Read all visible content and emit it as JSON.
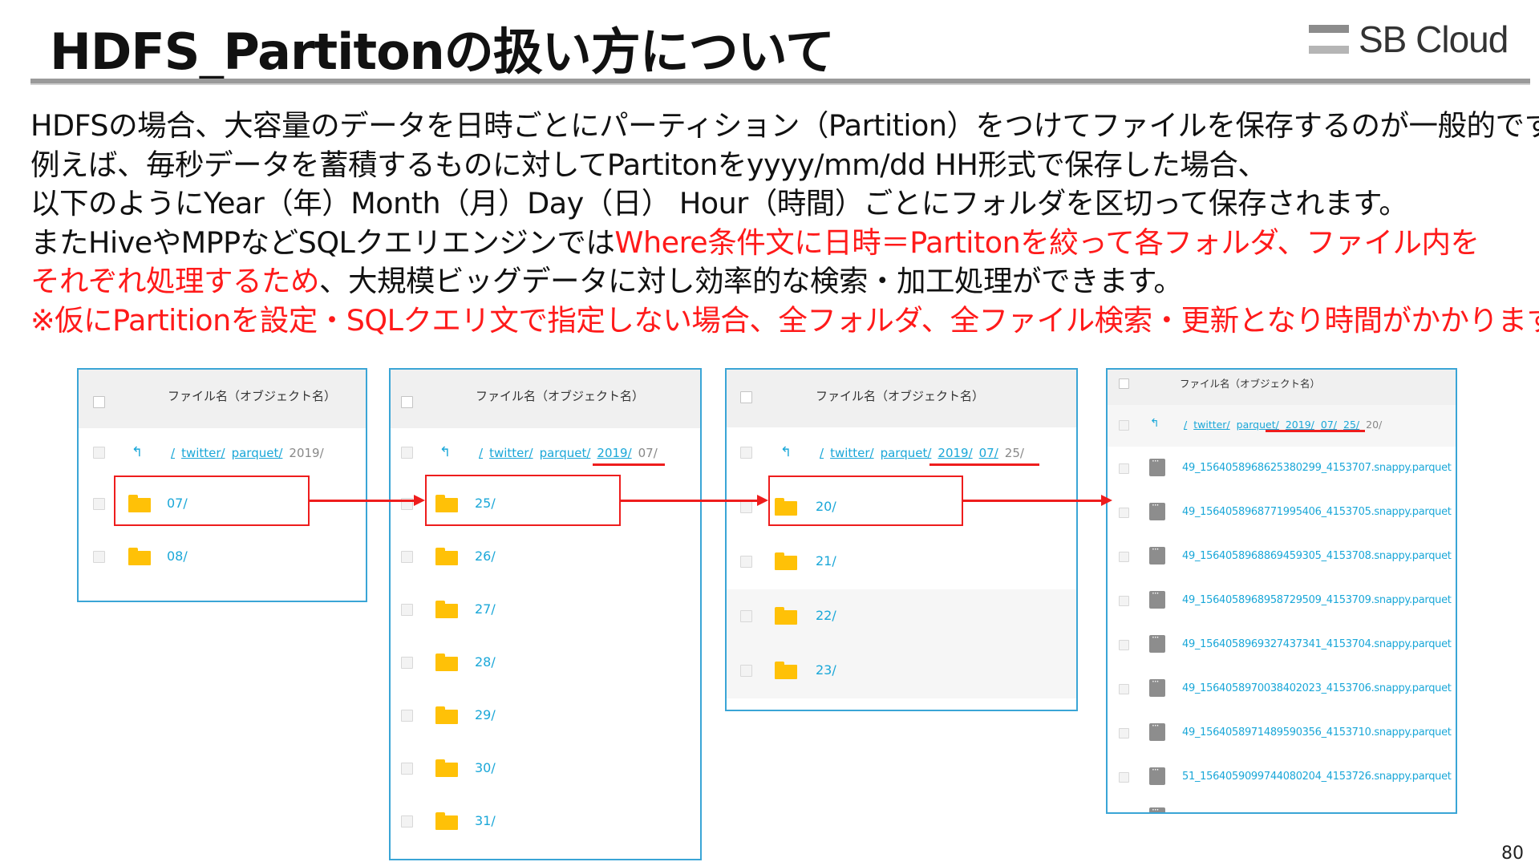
{
  "slide": {
    "title": "HDFS_Partitonの扱い方について",
    "logo_text": "SB Cloud",
    "page_number": "80"
  },
  "body": {
    "line1": "HDFSの場合、大容量のデータを日時ごとにパーティション（Partition）をつけてファイルを保存するのが一般的です。",
    "line2": "例えば、毎秒データを蓄積するものに対してPartitonをyyyy/mm/dd HH形式で保存した場合、",
    "line3": "以下のようにYear（年）Month（月）Day（日） Hour（時間）ごとにフォルダを区切って保存されます。",
    "line4_black": "またHiveやMPPなどSQLクエリエンジンでは",
    "line4_red": "Where条件文に日時＝Partitonを絞って各フォルダ、ファイル内を",
    "line5_red": "それぞれ処理するため",
    "line5_black": "、大規模ビッグデータに対し効率的な検索・加工処理ができます。",
    "line6": "※仮にPartitionを設定・SQLクエリ文で指定しない場合、全フォルダ、全ファイル検索・更新となり時間がかかります。"
  },
  "header_label": "ファイル名（オブジェクト名）",
  "crumbs": {
    "slash": "/",
    "twitter": "twitter/",
    "parquet": "parquet/",
    "year": "2019/",
    "month": "07/",
    "day": "25/",
    "hour": "20/"
  },
  "icons": {
    "back": "↰"
  },
  "panel1": {
    "folders": [
      "07/",
      "08/"
    ]
  },
  "panel2": {
    "folders": [
      "25/",
      "26/",
      "27/",
      "28/",
      "29/",
      "30/",
      "31/"
    ]
  },
  "panel3": {
    "folders": [
      "20/",
      "21/",
      "22/",
      "23/"
    ]
  },
  "panel4": {
    "files": [
      "49_1564058968625380299_4153707.snappy.parquet",
      "49_1564058968771995406_4153705.snappy.parquet",
      "49_1564058968869459305_4153708.snappy.parquet",
      "49_1564058968958729509_4153709.snappy.parquet",
      "49_1564058969327437341_4153704.snappy.parquet",
      "49_1564058970038402023_4153706.snappy.parquet",
      "49_1564058971489590356_4153710.snappy.parquet",
      "51_1564059099744080204_4153726.snappy.parquet"
    ]
  },
  "colors": {
    "accent_blue": "#1aa7d8",
    "highlight_red": "#ee1d1d",
    "folder_yellow": "#ffc107"
  }
}
